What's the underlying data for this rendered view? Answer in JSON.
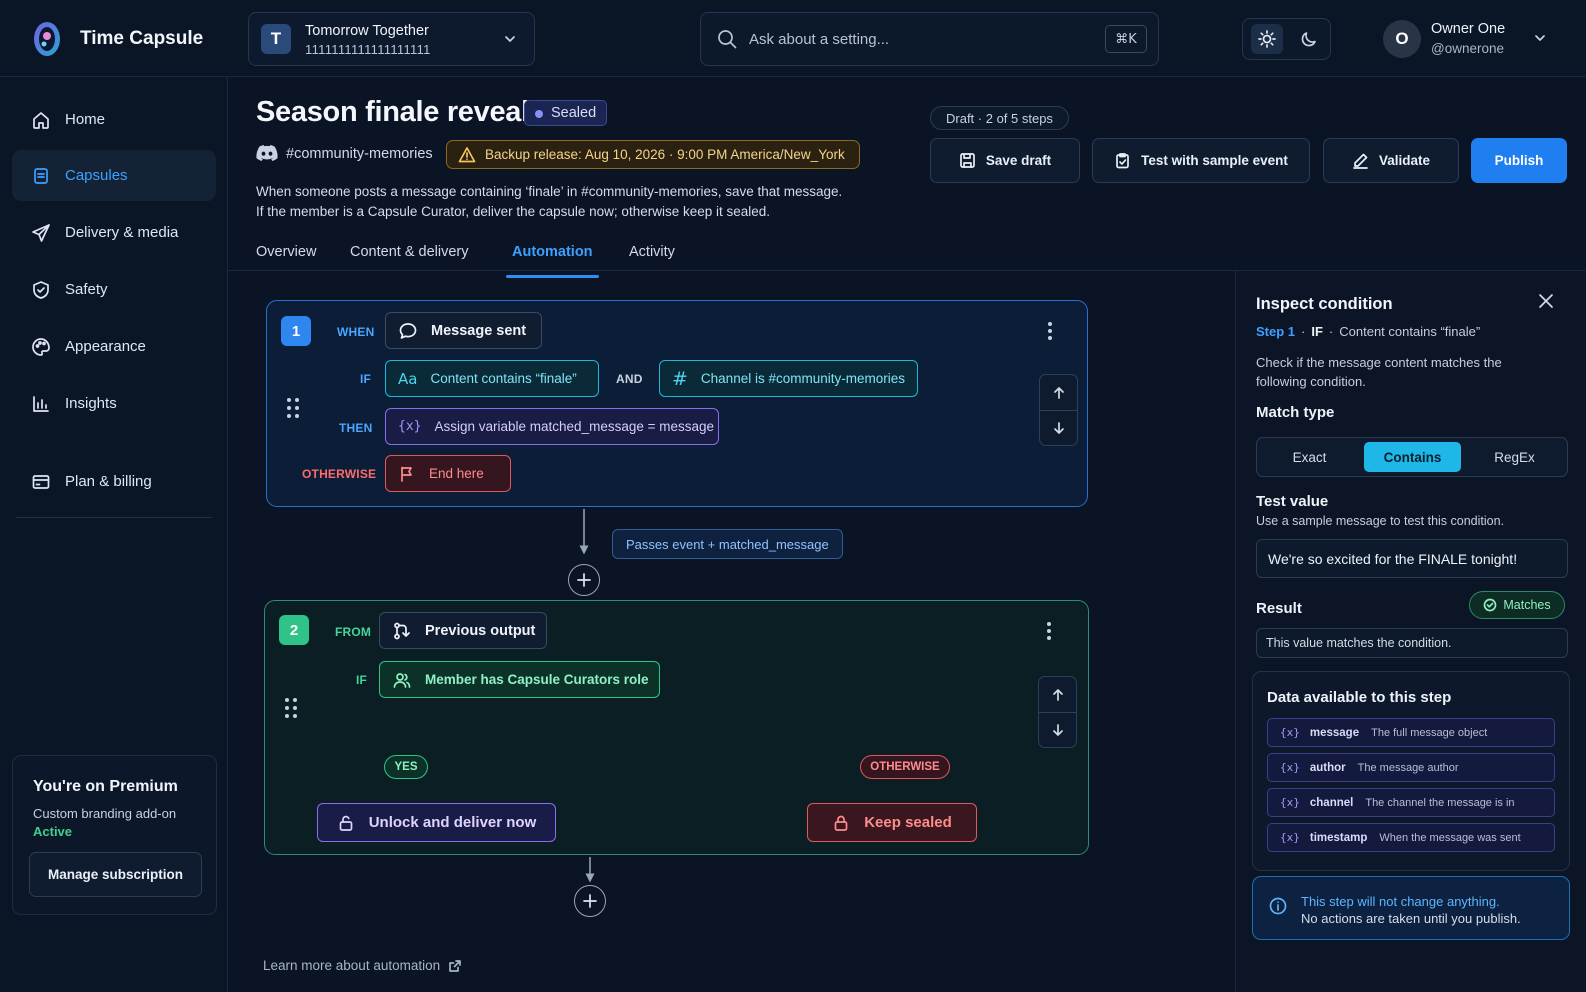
{
  "app": {
    "name": "Time Capsule"
  },
  "workspace": {
    "initial": "T",
    "name": "Tomorrow Together",
    "id": "1111111111111111111"
  },
  "search": {
    "placeholder": "Ask about a setting...",
    "shortcut": "⌘K"
  },
  "user": {
    "initial": "O",
    "name": "Owner One",
    "handle": "@ownerone"
  },
  "sidebar": {
    "items": [
      {
        "label": "Home",
        "icon": "home-icon"
      },
      {
        "label": "Capsules",
        "icon": "capsule-icon",
        "active": true
      },
      {
        "label": "Delivery & media",
        "icon": "send-icon"
      },
      {
        "label": "Safety",
        "icon": "shield-icon"
      },
      {
        "label": "Appearance",
        "icon": "palette-icon"
      },
      {
        "label": "Insights",
        "icon": "bar-chart-icon"
      },
      {
        "label": "Plan & billing",
        "icon": "billing-icon"
      }
    ],
    "premium": {
      "title": "You're on Premium",
      "addon": "Custom branding add-on",
      "status": "Active",
      "button": "Manage subscription"
    }
  },
  "header": {
    "title": "Season finale reveal",
    "status": "Sealed",
    "channel": "#community-memories",
    "backup": "Backup release:  Aug 10, 2026 · 9:00 PM America/New_York",
    "desc1": "When someone posts a message containing ‘finale’ in #community-memories, save that message.",
    "desc2": "If the member is a Capsule Curator, deliver the capsule now; otherwise keep it sealed.",
    "draft": "Draft · 2 of 5 steps",
    "buttons": {
      "save": "Save draft",
      "test": "Test with sample event",
      "validate": "Validate",
      "publish": "Publish"
    }
  },
  "tabs": [
    "Overview",
    "Content & delivery",
    "Automation",
    "Activity"
  ],
  "active_tab": "Automation",
  "step1": {
    "num": "1",
    "when_label": "WHEN",
    "trigger": "Message sent",
    "if_label": "IF",
    "cond1": "Content contains “finale”",
    "and_label": "AND",
    "cond2": "Channel is #community-memories",
    "then_label": "THEN",
    "action": "Assign variable matched_message = message",
    "otherwise_label": "OTHERWISE",
    "otherwise": "End here"
  },
  "connector": {
    "passes": "Passes event + matched_message"
  },
  "step2": {
    "num": "2",
    "from_label": "FROM",
    "source": "Previous output",
    "if_label": "IF",
    "cond": "Member has Capsule Curators role",
    "yes_label": "YES",
    "otherwise_label": "OTHERWISE",
    "yes_action": "Unlock and deliver now",
    "no_action": "Keep sealed"
  },
  "learn_more": "Learn more about automation",
  "inspect": {
    "title": "Inspect condition",
    "crumb_step": "Step 1",
    "crumb_if": "IF",
    "crumb_cond": "Content contains “finale”",
    "desc": "Check if the message content matches the following condition.",
    "match_type_label": "Match type",
    "match_types": [
      "Exact",
      "Contains",
      "RegEx"
    ],
    "selected_match": "Contains",
    "test_label": "Test value",
    "test_sub": "Use a sample message to test this condition.",
    "test_value": "We're so excited for the FINALE tonight!",
    "result_label": "Result",
    "result_badge": "Matches",
    "result_text": "This value matches the condition.",
    "data_title": "Data available to this step",
    "vars": [
      {
        "name": "message",
        "desc": "The full message object"
      },
      {
        "name": "author",
        "desc": "The message author"
      },
      {
        "name": "channel",
        "desc": "The channel the message is in"
      },
      {
        "name": "timestamp",
        "desc": "When the message was sent"
      }
    ],
    "info1": "This step will not change anything.",
    "info2": "No actions are taken until you publish."
  },
  "colors": {
    "accent": "#1f7ef0",
    "step1": "#2b6fcc",
    "step2": "#2d8c74",
    "cyan": "#1fb6d9",
    "purple": "#8b6cf0",
    "red": "#e0575d",
    "green": "#2fc389"
  }
}
